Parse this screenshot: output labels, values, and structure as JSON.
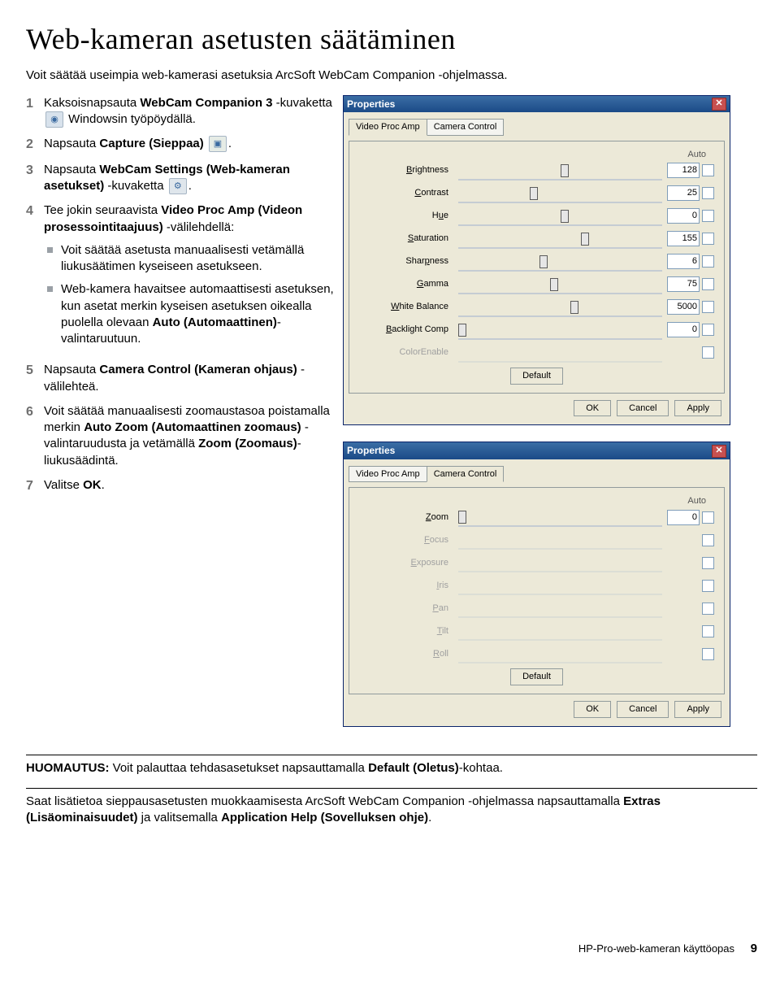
{
  "page": {
    "title": "Web-kameran asetusten säätäminen",
    "intro": "Voit säätää useimpia web-kamerasi asetuksia ArcSoft WebCam Companion -ohjelmassa.",
    "footer_doc": "HP-Pro-web-kameran käyttöopas",
    "footer_page": "9"
  },
  "steps": [
    {
      "n": "1",
      "parts": {
        "a": "Kaksoisnapsauta ",
        "b": "WebCam Companion 3",
        "c": " -kuvaketta ",
        "d": " Windowsin työpöydällä."
      }
    },
    {
      "n": "2",
      "parts": {
        "a": "Napsauta ",
        "b": "Capture (Sieppaa)",
        "c": " ",
        "d": "."
      }
    },
    {
      "n": "3",
      "parts": {
        "a": "Napsauta ",
        "b": "WebCam Settings (Web-kameran asetukset)",
        "c": " -kuvaketta ",
        "d": "."
      }
    },
    {
      "n": "4",
      "parts": {
        "a": "Tee jokin seuraavista ",
        "b": "Video Proc Amp (Videon prosessointitaajuus)",
        "c": " -välilehdellä:"
      }
    },
    {
      "n": "5",
      "parts": {
        "a": "Napsauta ",
        "b": "Camera Control (Kameran ohjaus)",
        "c": " -välilehteä."
      }
    },
    {
      "n": "6",
      "parts": {
        "a": "Voit säätää manuaalisesti zoomaustasoa poistamalla merkin ",
        "b": "Auto Zoom (Automaattinen zoomaus)",
        "c": " -valintaruudusta ja vetämällä ",
        "d": "Zoom (Zoomaus)",
        "e": "-liukusäädintä."
      }
    },
    {
      "n": "7",
      "parts": {
        "a": "Valitse ",
        "b": "OK",
        "c": "."
      }
    }
  ],
  "bullets4": [
    {
      "t": "Voit säätää asetusta manuaalisesti vetämällä liukusäätimen kyseiseen asetukseen."
    },
    {
      "a": "Web-kamera havaitsee automaattisesti asetuksen, kun asetat merkin kyseisen asetuksen oikealla puolella olevaan ",
      "b": "Auto (Automaattinen)",
      "c": "-valintaruutuun."
    }
  ],
  "note1": {
    "a": "HUOMAUTUS:",
    "b": " Voit palauttaa tehdasasetukset napsauttamalla ",
    "c": "Default (Oletus)",
    "d": "-kohtaa."
  },
  "note2": {
    "a": "Saat lisätietoa sieppausasetusten muokkaamisesta ArcSoft WebCam Companion -ohjelmassa napsauttamalla ",
    "b": "Extras (Lisäominaisuudet)",
    "c": " ja valitsemalla ",
    "d": "Application Help (Sovelluksen ohje)",
    "e": "."
  },
  "dialog1": {
    "title": "Properties",
    "tabs": [
      "Video Proc Amp",
      "Camera Control"
    ],
    "active_tab": 0,
    "auto_label": "Auto",
    "rows": [
      {
        "u": "B",
        "label": "rightness",
        "val": "128",
        "dim": false,
        "thumb": 50
      },
      {
        "u": "C",
        "label": "ontrast",
        "val": "25",
        "dim": false,
        "thumb": 35
      },
      {
        "u": "H",
        "label": "_ue",
        "val": "0",
        "dim": false,
        "thumb": 50
      },
      {
        "u": "S",
        "label": "aturation",
        "val": "155",
        "dim": false,
        "thumb": 60
      },
      {
        "u": "",
        "label": "Sharpness",
        "u2": "p",
        "val": "6",
        "dim": false,
        "thumb": 40
      },
      {
        "u": "G",
        "label": "amma",
        "val": "75",
        "dim": false,
        "thumb": 45
      },
      {
        "u": "W",
        "label": "hite Balance",
        "val": "5000",
        "dim": false,
        "thumb": 55
      },
      {
        "u": "B",
        "label": "acklight Comp",
        "val": "0",
        "dim": false,
        "thumb": 0
      },
      {
        "u": "",
        "label": "ColorEnable",
        "val": "",
        "dim": true,
        "thumb": 0
      }
    ],
    "default_btn": "Default",
    "buttons": [
      "OK",
      "Cancel",
      "Apply"
    ]
  },
  "dialog2": {
    "title": "Properties",
    "tabs": [
      "Video Proc Amp",
      "Camera Control"
    ],
    "active_tab": 1,
    "auto_label": "Auto",
    "rows": [
      {
        "u": "Z",
        "label": "oom",
        "val": "0",
        "dim": false,
        "thumb": 0
      },
      {
        "u": "F",
        "label": "ocus",
        "val": "",
        "dim": true,
        "thumb": 0
      },
      {
        "u": "E",
        "label": "xposure",
        "val": "",
        "dim": true,
        "thumb": 0
      },
      {
        "u": "I",
        "label": "ris",
        "val": "",
        "dim": true,
        "thumb": 0
      },
      {
        "u": "P",
        "label": "an",
        "val": "",
        "dim": true,
        "thumb": 0
      },
      {
        "u": "T",
        "label": "ilt",
        "val": "",
        "dim": true,
        "thumb": 0
      },
      {
        "u": "R",
        "label": "oll",
        "val": "",
        "dim": true,
        "thumb": 0
      }
    ],
    "default_btn": "Default",
    "buttons": [
      "OK",
      "Cancel",
      "Apply"
    ]
  }
}
